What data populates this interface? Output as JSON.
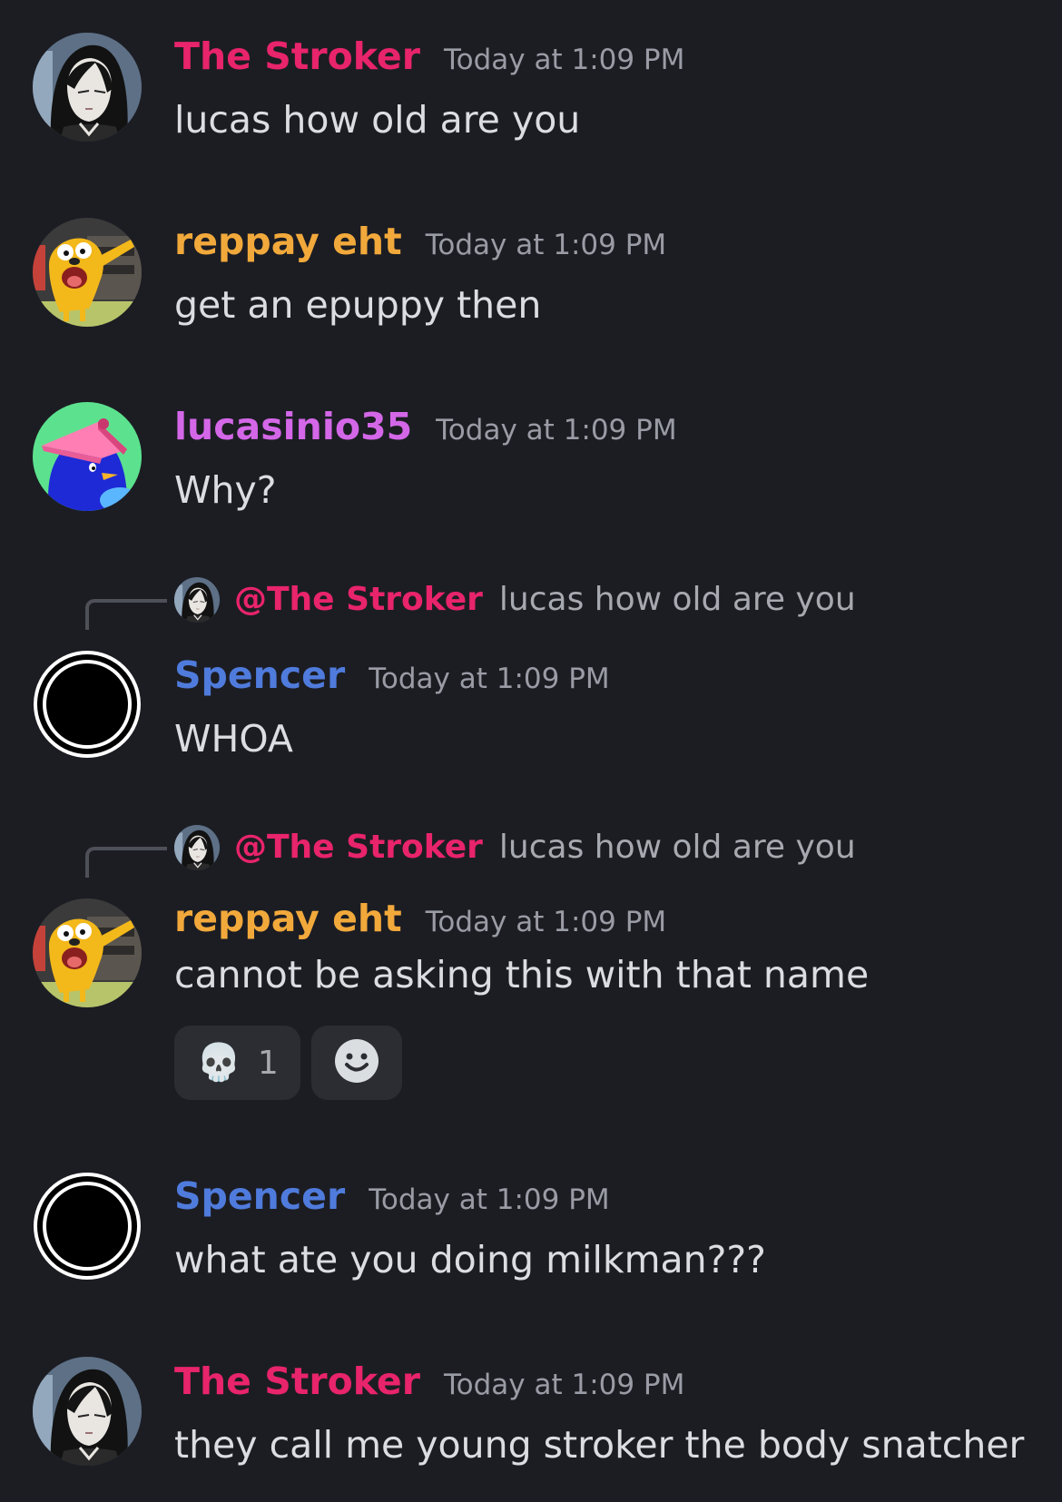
{
  "colors": {
    "background": "#1c1d23",
    "stroker": "#e8246a",
    "reppay": "#f2a93b",
    "lucas": "#d467e8",
    "spencer": "#4f7bdc"
  },
  "messages": [
    {
      "author": "The Stroker",
      "timestamp": "Today at 1:09 PM",
      "content": "lucas how old are you",
      "avatar": "anime-girl-avatar"
    },
    {
      "author": "reppay eht",
      "timestamp": "Today at 1:09 PM",
      "content": "get an epuppy then",
      "avatar": "jake-dog-avatar"
    },
    {
      "author": "lucasinio35",
      "timestamp": "Today at 1:09 PM",
      "content": "Why?",
      "avatar": "blue-bird-avatar"
    },
    {
      "reply": {
        "author": "@The Stroker",
        "snippet": "lucas how old are you"
      },
      "author": "Spencer",
      "timestamp": "Today at 1:09 PM",
      "content": "WHOA",
      "avatar": "black-circle-avatar"
    },
    {
      "reply": {
        "author": "@The Stroker",
        "snippet": "lucas how old are you"
      },
      "author": "reppay eht",
      "timestamp": "Today at 1:09 PM",
      "content": "cannot be asking this with that name",
      "avatar": "jake-dog-avatar",
      "reactions": [
        {
          "emoji": "💀",
          "count": "1"
        }
      ],
      "add_reaction_icon": "smile-icon"
    },
    {
      "author": "Spencer",
      "timestamp": "Today at 1:09 PM",
      "content": "what ate you doing milkman???",
      "avatar": "black-circle-avatar"
    },
    {
      "author": "The Stroker",
      "timestamp": "Today at 1:09 PM",
      "content": "they call me young stroker the body snatcher",
      "avatar": "anime-girl-avatar"
    }
  ]
}
